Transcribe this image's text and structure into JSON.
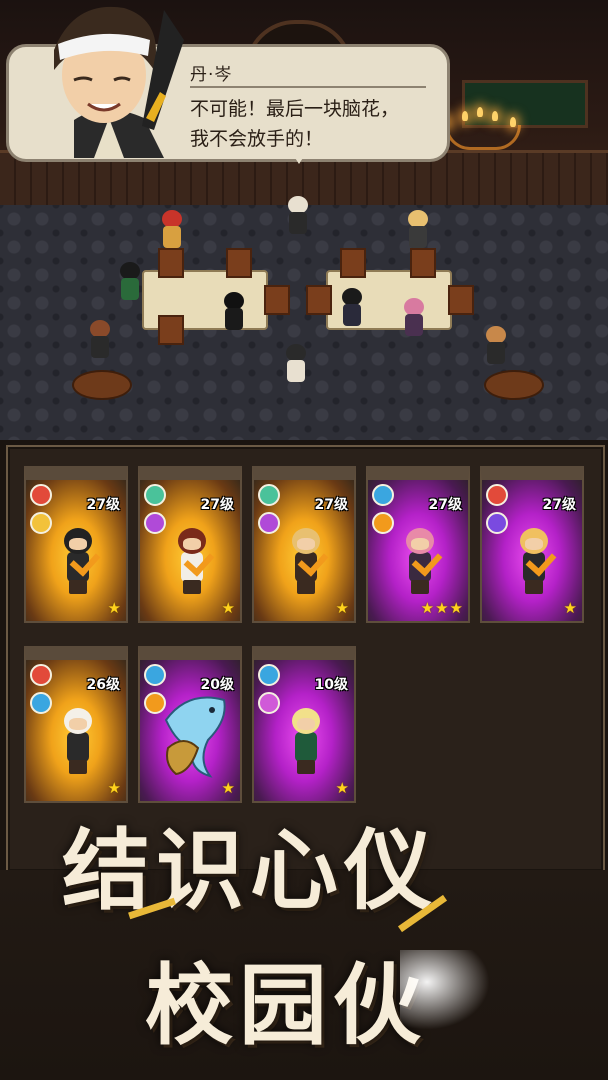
{
  "dialog": {
    "speaker": "丹·岑",
    "text": "不可能！最后一块脑花，我不会放手的！"
  },
  "cards": [
    {
      "level": "27级",
      "rarity": "gold",
      "stars": "★",
      "colors": {
        "orb1": "#e24a3a",
        "orb2": "#f2c23a",
        "hair": "#222222",
        "body": "#2a2a2a"
      },
      "selected": true
    },
    {
      "level": "27级",
      "rarity": "gold",
      "stars": "★",
      "colors": {
        "orb1": "#4ac29a",
        "orb2": "#b04ad8",
        "hair": "#7a2a1a",
        "body": "#f2eee6"
      },
      "selected": true
    },
    {
      "level": "27级",
      "rarity": "gold",
      "stars": "★",
      "colors": {
        "orb1": "#4ac29a",
        "orb2": "#b04ad8",
        "hair": "#e8c070",
        "body": "#3a2a20"
      },
      "selected": true
    },
    {
      "level": "27级",
      "rarity": "purple",
      "stars": "★★★",
      "colors": {
        "orb1": "#3aa6e0",
        "orb2": "#f29a1c",
        "hair": "#e88aa8",
        "body": "#3a2a40"
      },
      "selected": true
    },
    {
      "level": "27级",
      "rarity": "purple",
      "stars": "★",
      "colors": {
        "orb1": "#e24a3a",
        "orb2": "#7a4ae0",
        "hair": "#f0c060",
        "body": "#2a2a2a"
      },
      "selected": true
    },
    {
      "level": "26级",
      "rarity": "gold",
      "stars": "★",
      "colors": {
        "orb1": "#e24a3a",
        "orb2": "#3aa6e0",
        "hair": "#f4f0e8",
        "body": "#2a2a2a"
      },
      "selected": false
    },
    {
      "level": "20级",
      "rarity": "purple",
      "stars": "★",
      "colors": {
        "orb1": "#3aa6e0",
        "orb2": "#f29a1c",
        "hair": "#8fd4f0",
        "body": "#c89a3a"
      },
      "selected": false,
      "pet": "dolphin"
    },
    {
      "level": "10级",
      "rarity": "purple",
      "stars": "★",
      "colors": {
        "orb1": "#3aa6e0",
        "orb2": "#d05ad8",
        "hair": "#f2e08a",
        "body": "#1f5a3a"
      },
      "selected": false
    }
  ],
  "promo": {
    "line1": "结识心仪",
    "line2": "校园伙"
  },
  "theme": {
    "gold": "#f0a21a",
    "purple": "#b421c8",
    "star": "#ffd21c",
    "check": "#f29a1c"
  }
}
